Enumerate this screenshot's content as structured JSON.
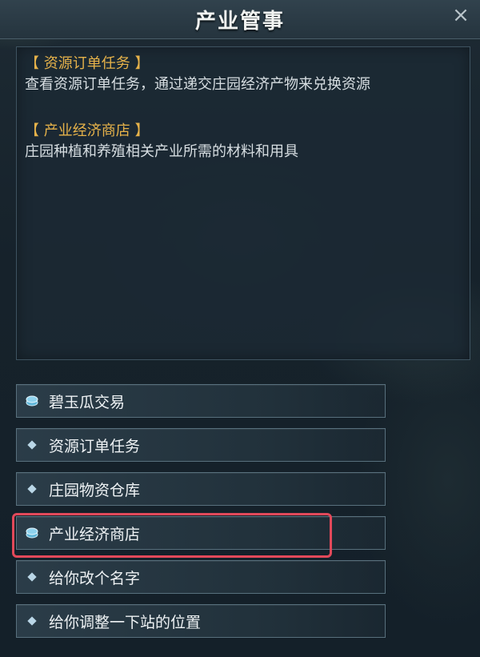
{
  "window": {
    "title": "产业管事",
    "close_label": "×"
  },
  "info": {
    "sections": [
      {
        "title": "【 资源订单任务 】",
        "desc": "查看资源订单任务，通过递交庄园经济产物来兑换资源"
      },
      {
        "title": "【 产业经济商店 】",
        "desc": "庄园种植和养殖相关产业所需的材料和用具"
      }
    ]
  },
  "menu": {
    "items": [
      {
        "label": "碧玉瓜交易",
        "icon": "coin-icon"
      },
      {
        "label": "资源订单任务",
        "icon": "diamond-icon"
      },
      {
        "label": "庄园物资仓库",
        "icon": "diamond-icon"
      },
      {
        "label": "产业经济商店",
        "icon": "coin-icon",
        "highlighted": true
      },
      {
        "label": "给你改个名字",
        "icon": "diamond-icon"
      },
      {
        "label": "给你调整一下站的位置",
        "icon": "diamond-icon"
      }
    ]
  },
  "colors": {
    "section_title": "#e6b24a",
    "highlight": "#e2495a"
  }
}
